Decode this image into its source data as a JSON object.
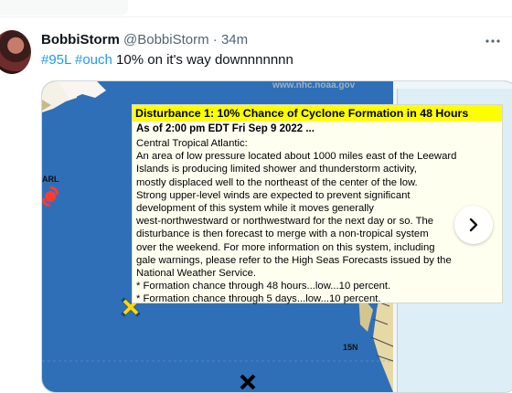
{
  "tweet": {
    "display_name": "BobbiStorm",
    "handle": "@BobbiStorm",
    "separator": "·",
    "time": "34m",
    "hashtags": [
      "#95L",
      "#ouch"
    ],
    "text": "10% on it's way downnnnnnn",
    "more_icon": "more-horizontal-icon"
  },
  "media": {
    "credit": "www.nhc.noaa.gov",
    "map_label_carl": "ARL",
    "map_label_lat": "15N",
    "next_icon": "chevron-right-icon",
    "outlook": {
      "title": "Disturbance 1: 10% Chance of Cyclone Formation in 48 Hours",
      "as_of": "As of 2:00 pm EDT Fri Sep 9 2022 ...",
      "lines": [
        "Central Tropical Atlantic:",
        "An area of low pressure located about 1000 miles east of the Leeward",
        "Islands is producing limited shower and thunderstorm activity,",
        "mostly displaced well to the northeast of the center of the low.",
        "Strong upper-level winds are expected to prevent significant",
        "development of this system while it moves generally",
        "west-northwestward or northwestward for the next day or so. The",
        "disturbance is then forecast to merge with a non-tropical system",
        "over the weekend. For more information on this system, including",
        "gale warnings, please refer to the High Seas Forecasts issued by the",
        "National Weather Service.",
        "* Formation chance through 48 hours...low...10 percent.",
        "* Formation chance through 5 days...low...10 percent."
      ]
    }
  }
}
